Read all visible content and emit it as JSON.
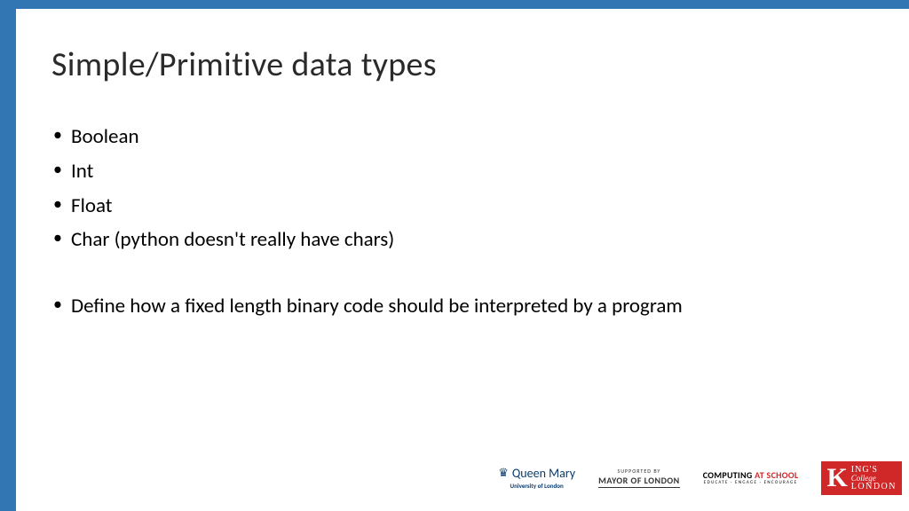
{
  "title": "Simple/Primitive data types",
  "bullets": {
    "b1": "Boolean",
    "b2": "Int",
    "b3": "Float",
    "b4": "Char (python doesn't really have chars)",
    "b5": "Define how a fixed length binary code should be interpreted by a program"
  },
  "logos": {
    "qmul_name": "Queen Mary",
    "qmul_sub": "University of London",
    "mayor_sup": "SUPPORTED BY",
    "mayor_name": "MAYOR OF LONDON",
    "cas_a": "COMPUTING ",
    "cas_b": "AT SCHOOL",
    "cas_sub": "EDUCATE · ENGAGE · ENCOURAGE",
    "kcl_k": "K",
    "kcl_ings": "ING'S",
    "kcl_college": "College",
    "kcl_london": "LONDON"
  }
}
